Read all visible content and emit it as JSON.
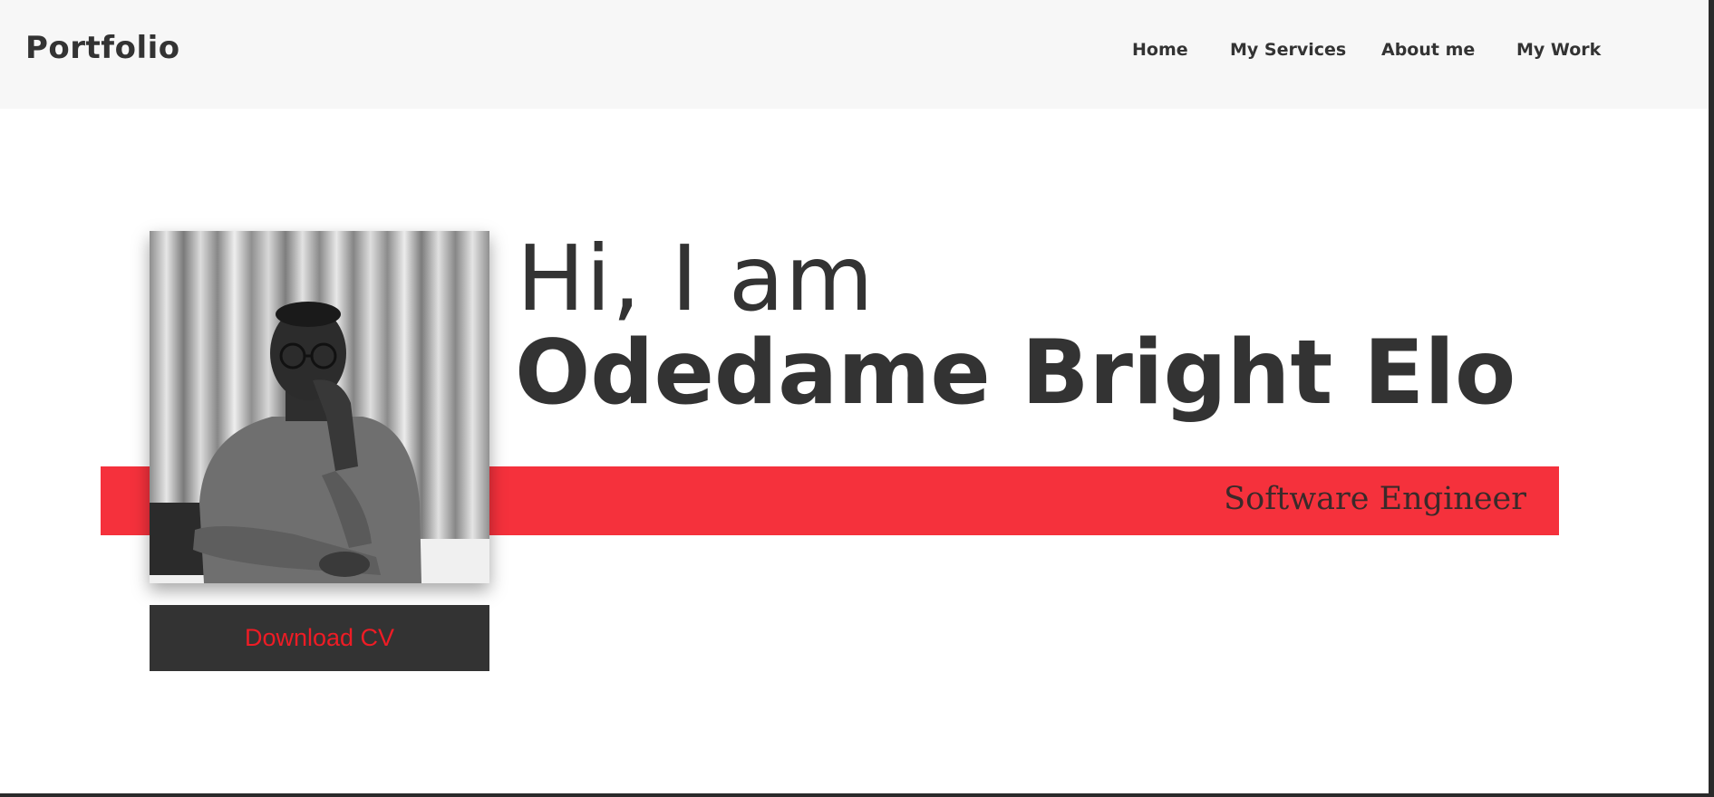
{
  "header": {
    "brand": "Portfolio",
    "nav": {
      "home": "Home",
      "services": "My Services",
      "about": "About me",
      "work": "My Work"
    }
  },
  "hero": {
    "greeting": "Hi, I am",
    "name": "Odedame Bright Elo",
    "role": "Software Engineer",
    "cv_button": "Download CV",
    "photo_alt": "portrait-photo"
  },
  "colors": {
    "accent": "#f5313c",
    "button_bg": "#333333",
    "button_text": "#ee1c25",
    "header_bg": "#f7f7f7",
    "text": "#333333"
  }
}
